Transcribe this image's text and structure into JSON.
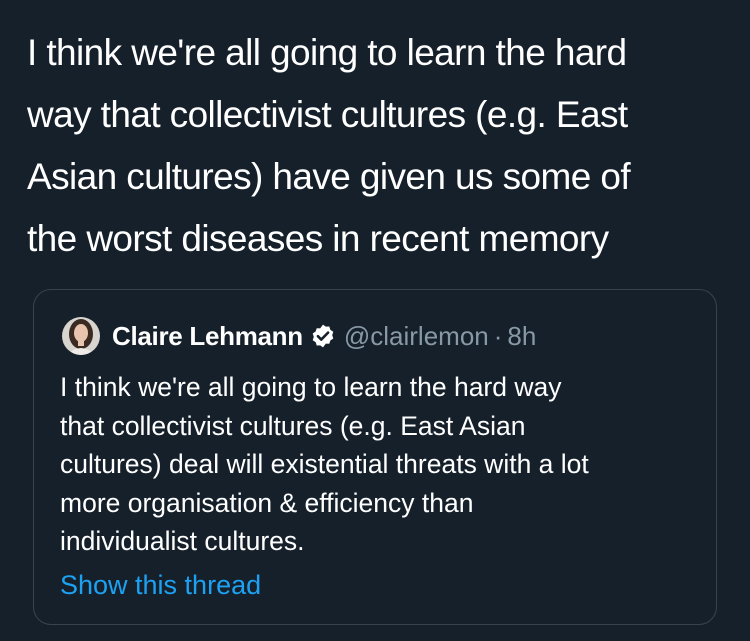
{
  "tweet": {
    "text": "I think we're all going to learn the hard\nway that collectivist cultures (e.g. East\nAsian cultures) have given us some of\nthe worst diseases in recent memory"
  },
  "quoted_tweet": {
    "author_name": "Claire Lehmann",
    "handle": "@clairlemon",
    "separator": "·",
    "timestamp": "8h",
    "verified_icon": "verified-badge-icon",
    "text": "I think we're all going to learn the hard way\nthat collectivist cultures (e.g. East Asian\ncultures) deal will existential threats with a lot\nmore organisation & efficiency than\nindividualist cultures.",
    "show_thread_label": "Show this thread"
  },
  "colors": {
    "background": "#15202b",
    "card_border": "#38444d",
    "primary_text": "#ffffff",
    "secondary_text": "#8899a6",
    "link": "#1da1f2"
  }
}
